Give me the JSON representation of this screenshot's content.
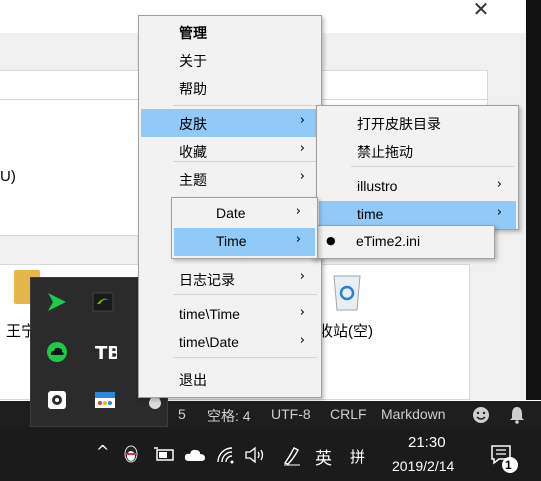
{
  "background": {
    "partial_label_u": "U)",
    "folder_label": "王宁",
    "recycle_label": "收站(空)"
  },
  "main_menu": {
    "items": [
      {
        "label": "管理",
        "bold": true
      },
      {
        "label": "关于"
      },
      {
        "label": "帮助"
      },
      {
        "label": "皮肤",
        "submenu": true,
        "highlighted": true
      },
      {
        "label": "收藏",
        "submenu": true
      },
      {
        "label": "主题",
        "submenu": true
      },
      {
        "label": "日志记录",
        "submenu": true
      },
      {
        "label": "time\\Time",
        "submenu": true
      },
      {
        "label": "time\\Date",
        "submenu": true
      },
      {
        "label": "退出"
      }
    ],
    "arrow": "›"
  },
  "skin_menu": {
    "items": [
      {
        "label": "打开皮肤目录"
      },
      {
        "label": "禁止拖动"
      },
      {
        "label": "illustro",
        "submenu": true
      },
      {
        "label": "time",
        "submenu": true,
        "highlighted": true
      }
    ]
  },
  "time_menu": {
    "items": [
      {
        "label": "eTime2.ini",
        "checked": true
      }
    ],
    "bullet": "●"
  },
  "left_menu": {
    "items": [
      {
        "label": "Date",
        "submenu": true
      },
      {
        "label": "Time",
        "submenu": true,
        "highlighted": true
      }
    ]
  },
  "statusbar": {
    "partial": "5",
    "spaces": "空格: 4",
    "encoding": "UTF-8",
    "eol": "CRLF",
    "language": "Markdown"
  },
  "taskbar": {
    "chevron": "^",
    "ime_lang": "英",
    "ime_mode": "拼",
    "time": "21:30",
    "date": "2019/2/14",
    "notification_count": "1"
  },
  "colors": {
    "menu_bg": "#f2f2f2",
    "menu_highlight": "#91c9f7",
    "taskbar_bg": "#1b1b1b",
    "statusbar_bg": "#1e1e1e"
  }
}
